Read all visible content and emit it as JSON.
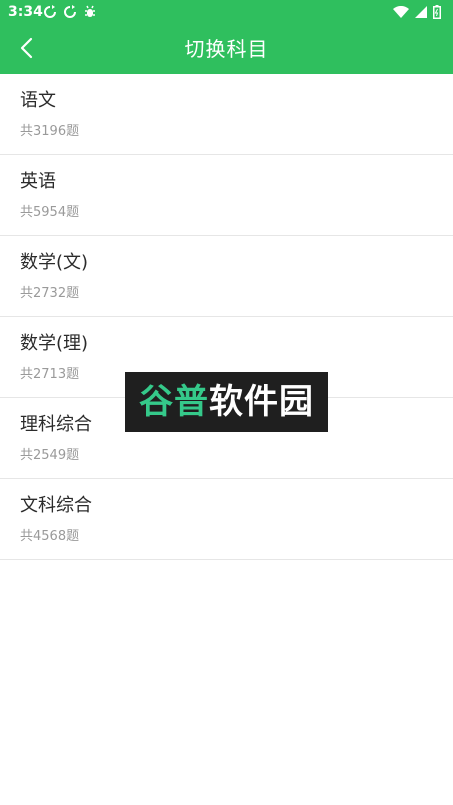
{
  "status_bar": {
    "time": "3:34",
    "icons": [
      "sync-icon",
      "sync-icon",
      "bug-icon"
    ],
    "right_icons": [
      "wifi-icon",
      "signal-icon",
      "battery-icon"
    ]
  },
  "header": {
    "title": "切换科目",
    "background": "#2fbf5e"
  },
  "subjects": [
    {
      "name": "语文",
      "count": "共3196题"
    },
    {
      "name": "英语",
      "count": "共5954题"
    },
    {
      "name": "数学(文)",
      "count": "共2732题"
    },
    {
      "name": "数学(理)",
      "count": "共2713题"
    },
    {
      "name": "理科综合",
      "count": "共2549题"
    },
    {
      "name": "文科综合",
      "count": "共4568题"
    }
  ],
  "watermark": {
    "part1": "谷普",
    "part2": "软件园"
  }
}
